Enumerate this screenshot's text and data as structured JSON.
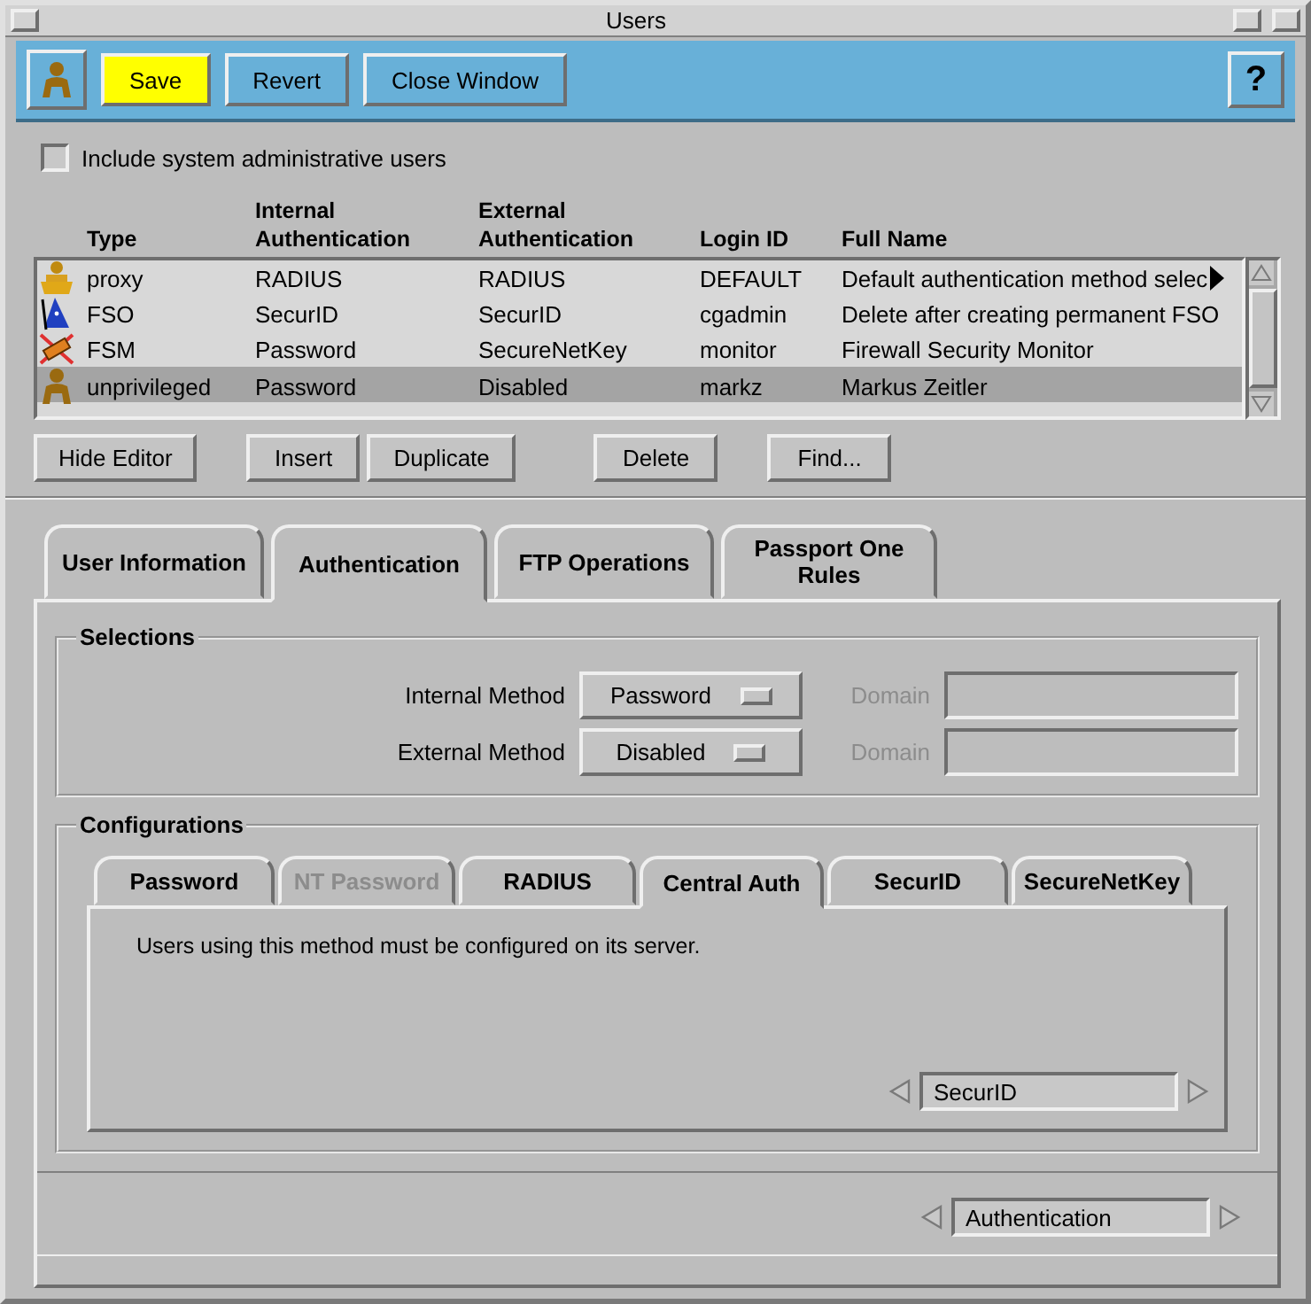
{
  "window": {
    "title": "Users"
  },
  "toolbar": {
    "buttons": [
      {
        "label": "Save",
        "kind": "primary"
      },
      {
        "label": "Revert",
        "kind": "normal"
      },
      {
        "label": "Close Window",
        "kind": "normal"
      }
    ],
    "help": "?"
  },
  "include_system": {
    "label": "Include system administrative users",
    "checked": false
  },
  "table": {
    "columns": [
      "Type",
      "Internal Authentication",
      "External Authentication",
      "Login ID",
      "Full Name"
    ],
    "rows": [
      {
        "kind": "proxy",
        "cells": [
          "proxy",
          "RADIUS",
          "RADIUS",
          "DEFAULT",
          "Default authentication method selec"
        ],
        "truncated": true,
        "selected": false
      },
      {
        "kind": "fso",
        "cells": [
          "FSO",
          "SecurID",
          "SecurID",
          "cgadmin",
          "Delete after creating permanent FSO"
        ],
        "truncated": false,
        "selected": false
      },
      {
        "kind": "fsm",
        "cells": [
          "FSM",
          "Password",
          "SecureNetKey",
          "monitor",
          "Firewall Security Monitor"
        ],
        "truncated": false,
        "selected": false
      },
      {
        "kind": "user",
        "cells": [
          "unprivileged",
          "Password",
          "Disabled",
          "markz",
          "Markus Zeitler"
        ],
        "truncated": false,
        "selected": true
      }
    ]
  },
  "editor_buttons": [
    "Hide Editor",
    "Insert",
    "Duplicate",
    "Delete",
    "Find..."
  ],
  "tabs": [
    {
      "label": "User Information",
      "selected": false
    },
    {
      "label": "Authentication",
      "selected": true
    },
    {
      "label": "FTP Operations",
      "selected": false
    },
    {
      "label": "Passport One Rules",
      "selected": false
    }
  ],
  "selections": {
    "title": "Selections",
    "rows": [
      {
        "label": "Internal Method",
        "value": "Password",
        "domain_label": "Domain",
        "domain_disabled": true
      },
      {
        "label": "External Method",
        "value": "Disabled",
        "domain_label": "Domain",
        "domain_disabled": true
      }
    ]
  },
  "configurations": {
    "title": "Configurations",
    "tabs": [
      {
        "label": "Password",
        "selected": false,
        "disabled": false
      },
      {
        "label": "NT Password",
        "selected": false,
        "disabled": true
      },
      {
        "label": "RADIUS",
        "selected": false,
        "disabled": false
      },
      {
        "label": "Central Auth",
        "selected": true,
        "disabled": false
      },
      {
        "label": "SecurID",
        "selected": false,
        "disabled": false
      },
      {
        "label": "SecureNetKey",
        "selected": false,
        "disabled": false
      }
    ],
    "message": "Users using this method must be configured on its server.",
    "spinner": {
      "value": "SecurID"
    }
  },
  "page_spinner": {
    "value": "Authentication"
  }
}
